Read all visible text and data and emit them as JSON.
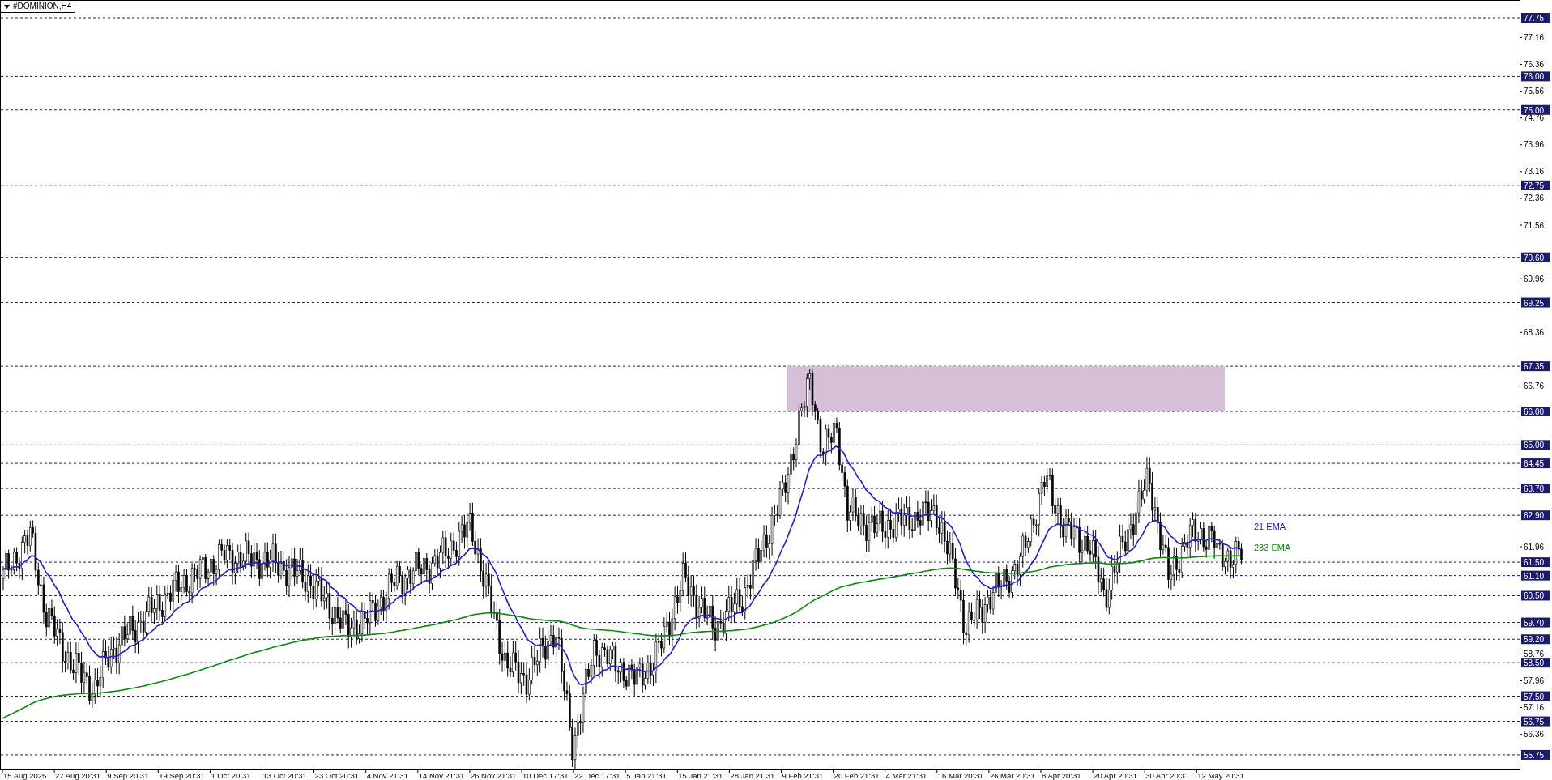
{
  "chart": {
    "title": "#DOMINION,H4",
    "levels": [
      {
        "label": "77.75"
      },
      {
        "label": "76.00"
      },
      {
        "label": "75.00"
      },
      {
        "label": "72.75"
      },
      {
        "label": "70.60"
      },
      {
        "label": "69.25"
      },
      {
        "label": "67.35"
      },
      {
        "label": "66.00"
      },
      {
        "label": "65.00"
      },
      {
        "label": "64.45"
      },
      {
        "label": "63.70"
      },
      {
        "label": "62.90"
      },
      {
        "label": "61.50"
      },
      {
        "label": "61.10"
      },
      {
        "label": "60.50"
      },
      {
        "label": "59.70"
      },
      {
        "label": "59.20"
      },
      {
        "label": "58.50"
      },
      {
        "label": "57.50"
      },
      {
        "label": "56.75"
      },
      {
        "label": "55.75"
      }
    ],
    "price_ticks": [
      "77.16",
      "76.36",
      "75.56",
      "74.76",
      "73.96",
      "73.16",
      "72.36",
      "71.56",
      "69.96",
      "68.36",
      "66.76",
      "61.96",
      "58.76",
      "57.96",
      "57.16",
      "56.36"
    ],
    "time_labels": [
      "15 Aug 2025",
      "27 Aug 20:31",
      "9 Sep 20:31",
      "19 Sep 20:31",
      "1 Oct 20:31",
      "13 Oct 20:31",
      "23 Oct 20:31",
      "4 Nov 21:31",
      "14 Nov 21:31",
      "26 Nov 21:31",
      "10 Dec 17:31",
      "22 Dec 17:31",
      "5 Jan 21:31",
      "15 Jan 21:31",
      "28 Jan 21:31",
      "9 Feb 21:31",
      "20 Feb 21:31",
      "4 Mar 21:31",
      "16 Mar 20:31",
      "26 Mar 20:31",
      "8 Apr 20:31",
      "20 Apr 20:31",
      "30 Apr 20:31",
      "12 May 20:31"
    ],
    "indicators": [
      {
        "label": "21 EMA",
        "color": "#1f1fd8"
      },
      {
        "label": "233 EMA",
        "color": "#0b8a0b"
      }
    ]
  }
}
